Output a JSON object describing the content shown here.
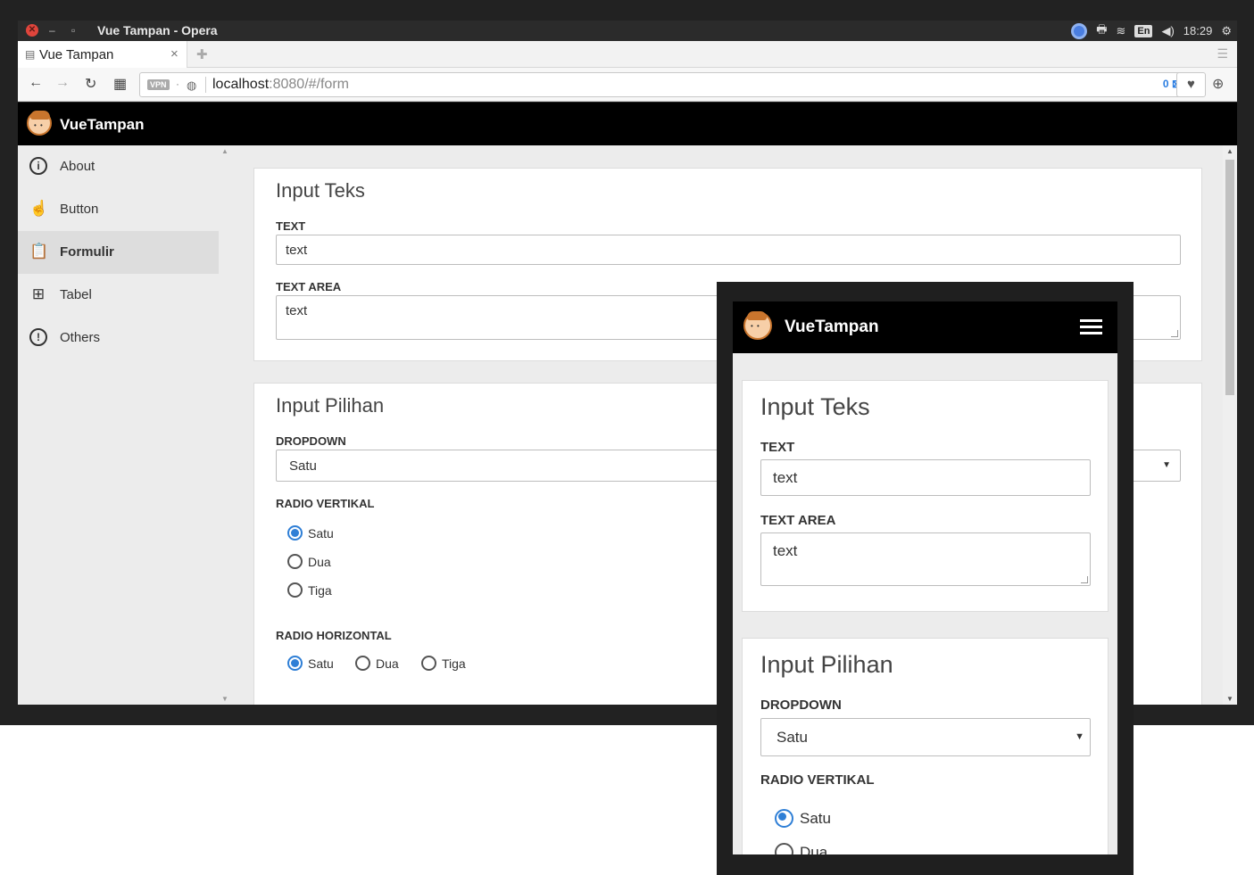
{
  "window": {
    "title": "Vue Tampan - Opera"
  },
  "tray": {
    "lang": "En",
    "time": "18:29"
  },
  "tab": {
    "label": "Vue Tampan"
  },
  "address": {
    "host": "localhost",
    "path": ":8080/#/form",
    "vpn": "VPN",
    "badge": "0"
  },
  "app": {
    "brand": "VueTampan"
  },
  "sidebar": {
    "items": [
      {
        "label": "About",
        "icon": "info-icon"
      },
      {
        "label": "Button",
        "icon": "pointer-hand-icon"
      },
      {
        "label": "Formulir",
        "icon": "clipboard-icon",
        "active": true
      },
      {
        "label": "Tabel",
        "icon": "grid-icon"
      },
      {
        "label": "Others",
        "icon": "alert-icon"
      }
    ]
  },
  "form": {
    "text_card": {
      "title": "Input Teks",
      "text_label": "TEXT",
      "text_value": "text",
      "textarea_label": "TEXT AREA",
      "textarea_value": "text"
    },
    "choice_card": {
      "title": "Input Pilihan",
      "dropdown_label": "DROPDOWN",
      "dropdown_value": "Satu",
      "radio_vertical_label": "RADIO VERTIKAL",
      "radio_horizontal_label": "RADIO HORIZONTAL",
      "options": [
        "Satu",
        "Dua",
        "Tiga"
      ],
      "selected": "Satu"
    }
  },
  "mobile_clipped_option": "Dua",
  "colors": {
    "accent": "#2f7fd6",
    "appbar": "#000000",
    "sidebar": "#ececec"
  }
}
